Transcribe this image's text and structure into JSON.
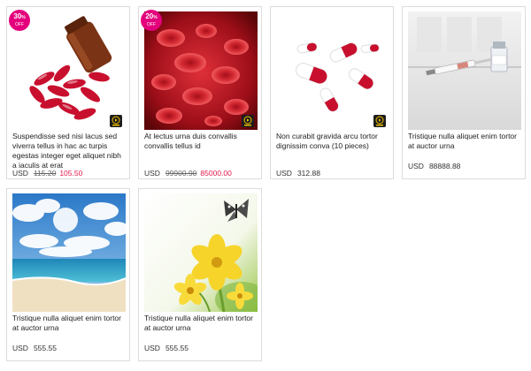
{
  "products": [
    {
      "badge": "30",
      "badge_sub": "OFF",
      "badge_pct": "%",
      "video_icon": "video-play-icon",
      "title": "Suspendisse sed nisi lacus sed viverra tellus in hac ac turpis egestas integer eget aliquet nibh a iaculis at erat",
      "currency": "USD",
      "old_price": "115.20",
      "price": "105.50",
      "image": "red-capsules-bottle"
    },
    {
      "badge": "20",
      "badge_sub": "OFF",
      "badge_pct": "%",
      "video_icon": "video-play-icon",
      "title": "At lectus urna duis convallis convallis tellus id",
      "currency": "USD",
      "old_price": "99900.90",
      "price": "85000.00",
      "image": "red-blood-cells"
    },
    {
      "video_icon": "video-play-icon",
      "title": "Non curabit gravida arcu tortor dignissim conva (10 pieces)",
      "currency": "USD",
      "price": "312.88",
      "image": "red-white-pills"
    },
    {
      "title": "Tristique nulla aliquet enim tortor at auctor urna",
      "currency": "USD",
      "price": "88888.88",
      "image": "syringe-vial"
    },
    {
      "title": "Tristique nulla aliquet enim tortor at auctor urna",
      "currency": "USD",
      "price": "555.55",
      "image": "beach-sky"
    },
    {
      "title": "Tristique nulla aliquet enim tortor at auctor urna",
      "currency": "USD",
      "price": "555.55",
      "image": "yellow-flower-butterfly"
    }
  ],
  "colors": {
    "sale": "#e51b4d",
    "badge": "#e4007c",
    "border": "#dcdcdc"
  }
}
